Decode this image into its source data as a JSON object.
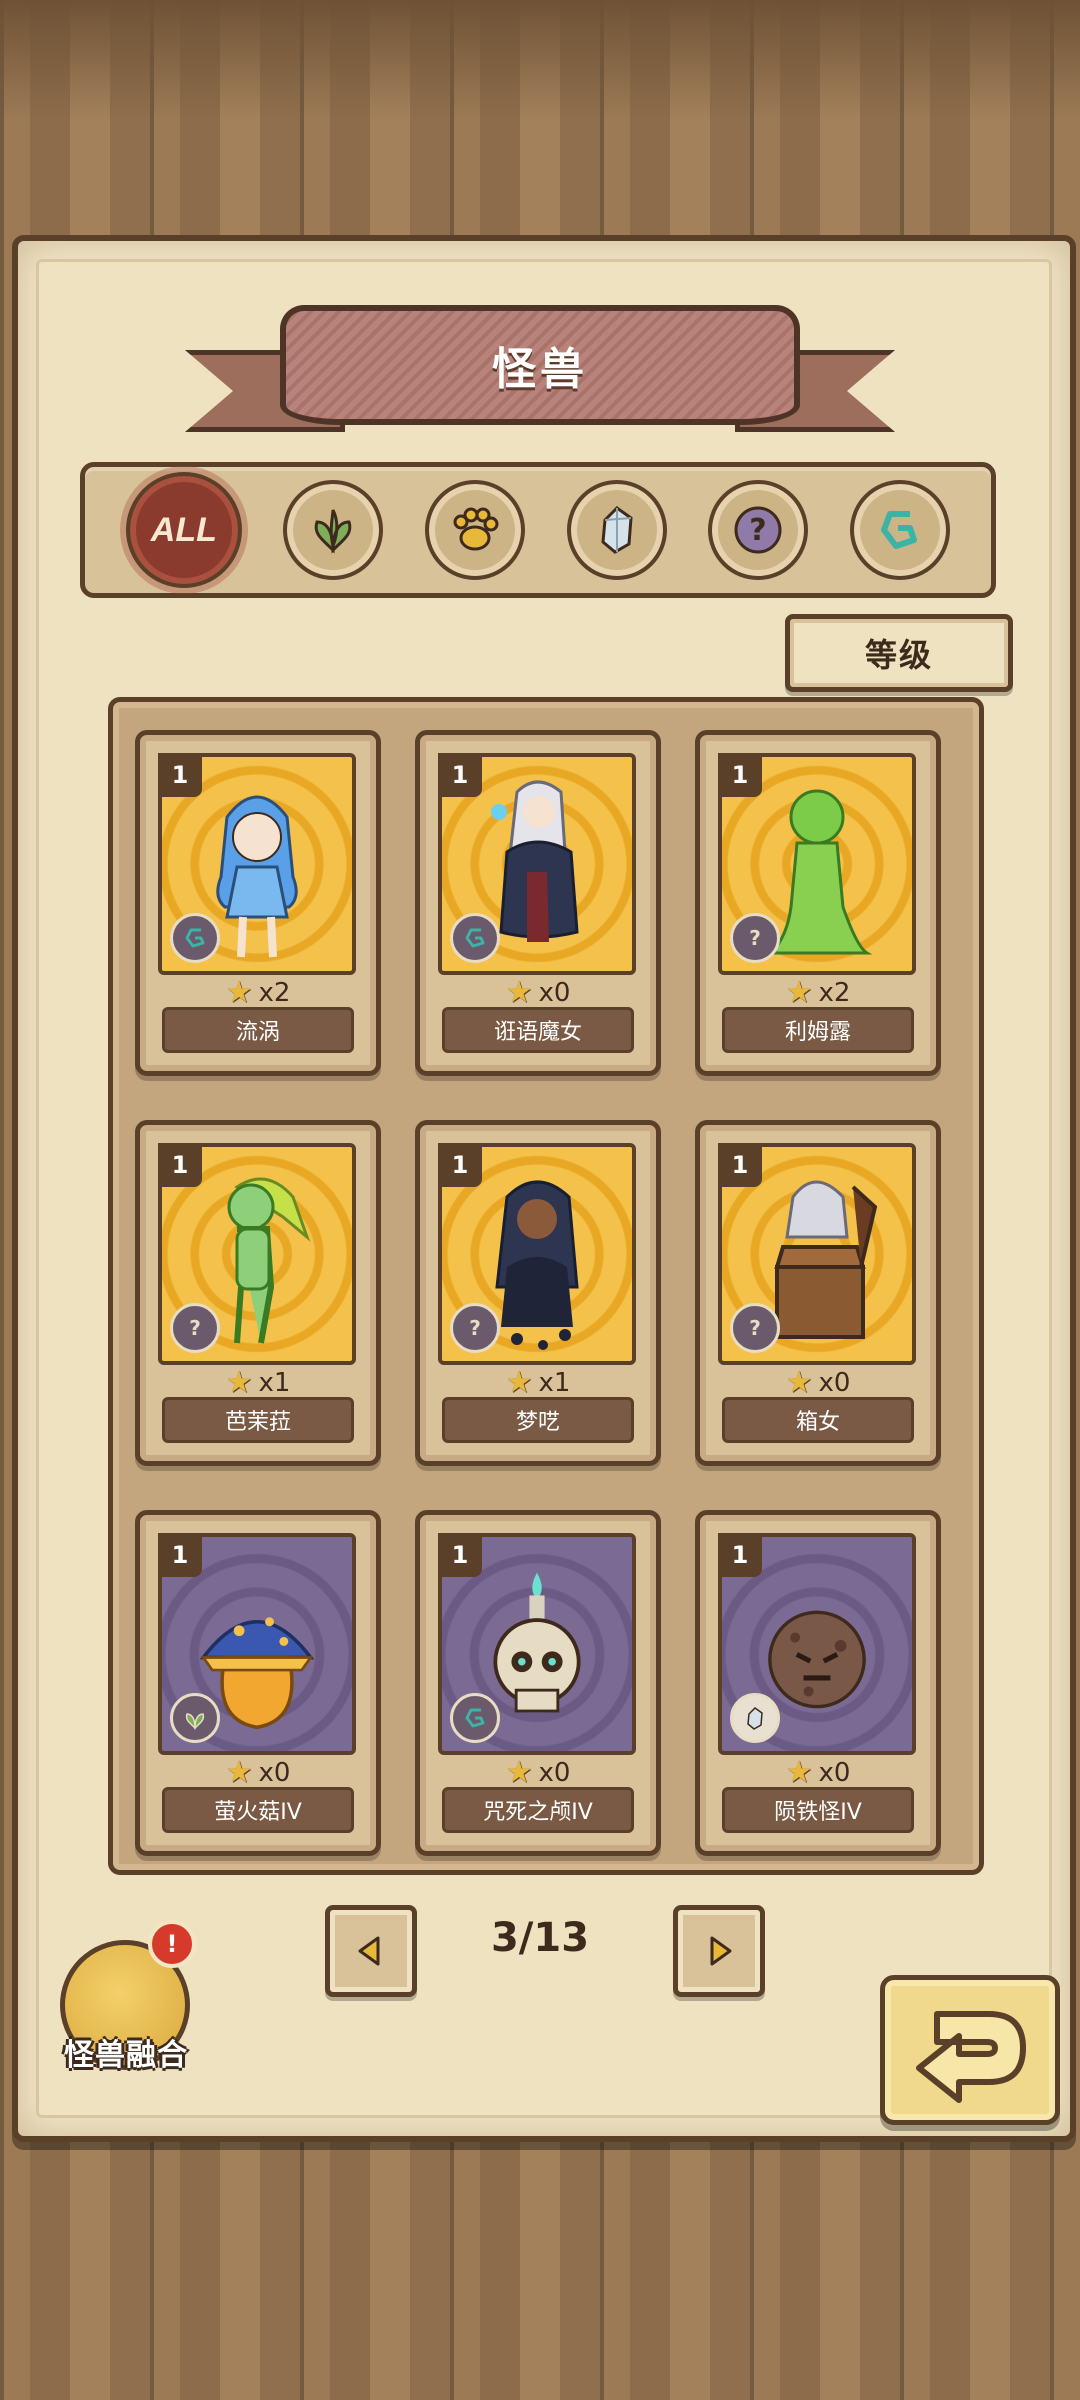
{
  "screen": {
    "title": "怪兽"
  },
  "filters": [
    {
      "id": "all",
      "label": "ALL",
      "icon": "all-icon",
      "selected": true
    },
    {
      "id": "plant",
      "icon": "leaf-icon",
      "selected": false
    },
    {
      "id": "beast",
      "icon": "paw-icon",
      "selected": false
    },
    {
      "id": "mineral",
      "icon": "crystal-icon",
      "selected": false
    },
    {
      "id": "unknown",
      "icon": "question-icon",
      "selected": false
    },
    {
      "id": "water",
      "icon": "swirl-icon",
      "selected": false
    }
  ],
  "sort": {
    "label": "等级"
  },
  "cards": [
    {
      "level": "1",
      "count": "x2",
      "name": "流涡",
      "bg": "gold",
      "type": "swirl-icon"
    },
    {
      "level": "1",
      "count": "x0",
      "name": "诳语魔女",
      "bg": "gold",
      "type": "swirl-icon"
    },
    {
      "level": "1",
      "count": "x2",
      "name": "利姆露",
      "bg": "gold",
      "type": "question-icon"
    },
    {
      "level": "1",
      "count": "x1",
      "name": "芭茉菈",
      "bg": "gold",
      "type": "question-icon"
    },
    {
      "level": "1",
      "count": "x1",
      "name": "梦呓",
      "bg": "gold",
      "type": "question-icon"
    },
    {
      "level": "1",
      "count": "x0",
      "name": "箱女",
      "bg": "gold",
      "type": "question-icon"
    },
    {
      "level": "1",
      "count": "x0",
      "name": "萤火菇IV",
      "bg": "purple",
      "type": "leaf-icon"
    },
    {
      "level": "1",
      "count": "x0",
      "name": "咒死之颅IV",
      "bg": "purple",
      "type": "swirl-icon"
    },
    {
      "level": "1",
      "count": "x0",
      "name": "陨铁怪IV",
      "bg": "purple",
      "type": "crystal-icon"
    }
  ],
  "pager": {
    "current": "3/13"
  },
  "fuse": {
    "label": "怪兽融合",
    "badge": "!"
  },
  "colors": {
    "accent": "#8a3b2e",
    "wood": "#5a4028",
    "paper": "#f1e6c8",
    "gold": "#f4c24a"
  }
}
